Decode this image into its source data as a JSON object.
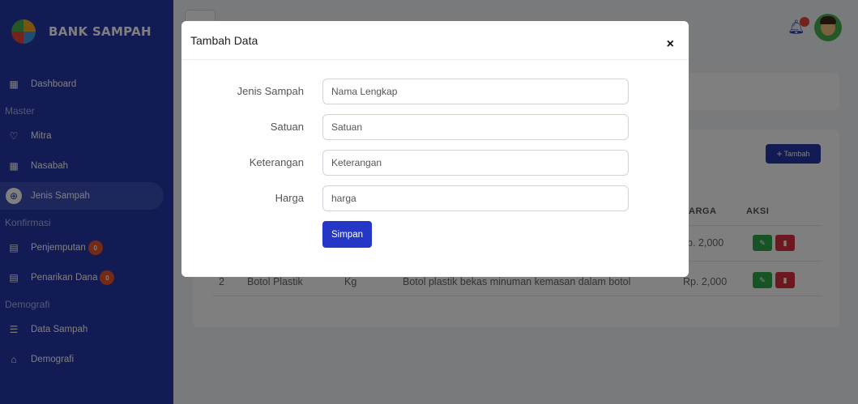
{
  "sidebar": {
    "brand": "BANK SAMPAH",
    "sections": {
      "master": "Master",
      "konfirmasi": "Konfirmasi",
      "demografi": "Demografi"
    },
    "items": [
      {
        "label": "Dashboard",
        "icon": "dashboard-icon"
      },
      {
        "label": "Mitra",
        "icon": "heart-icon"
      },
      {
        "label": "Nasabah",
        "icon": "id-card-icon"
      },
      {
        "label": "Jenis Sampah",
        "icon": "globe-icon",
        "active": true
      },
      {
        "label": "Penjemputan",
        "icon": "document-icon",
        "badge": "0"
      },
      {
        "label": "Penarikan Dana",
        "icon": "document-icon",
        "badge": "0"
      },
      {
        "label": "Data Sampah",
        "icon": "list-icon"
      },
      {
        "label": "Demografi",
        "icon": "building-icon"
      }
    ]
  },
  "background": {
    "add_button": "Tambah",
    "columns": [
      "ARGA",
      "AKSI"
    ],
    "rows": [
      {
        "no": "",
        "jenis": "",
        "satuan": "",
        "keterangan": "",
        "harga": "p. 2,000"
      },
      {
        "no": "2",
        "jenis": "Botol Plastik",
        "satuan": "Kg",
        "keterangan": "Botol plastik bekas minuman kemasan dalam botol",
        "harga": "Rp. 2,000"
      }
    ]
  },
  "modal": {
    "title": "Tambah Data",
    "close": "×",
    "fields": [
      {
        "label": "Jenis Sampah",
        "placeholder": "Nama Lengkap"
      },
      {
        "label": "Satuan",
        "placeholder": "Satuan"
      },
      {
        "label": "Keterangan",
        "placeholder": "Keterangan"
      },
      {
        "label": "Harga",
        "placeholder": "harga"
      }
    ],
    "submit": "Simpan"
  },
  "colors": {
    "sidebar": "#2537a8",
    "primary_button": "#2537c6",
    "badge": "#e8552b",
    "edit": "#2ea84a",
    "delete": "#d9303c"
  }
}
